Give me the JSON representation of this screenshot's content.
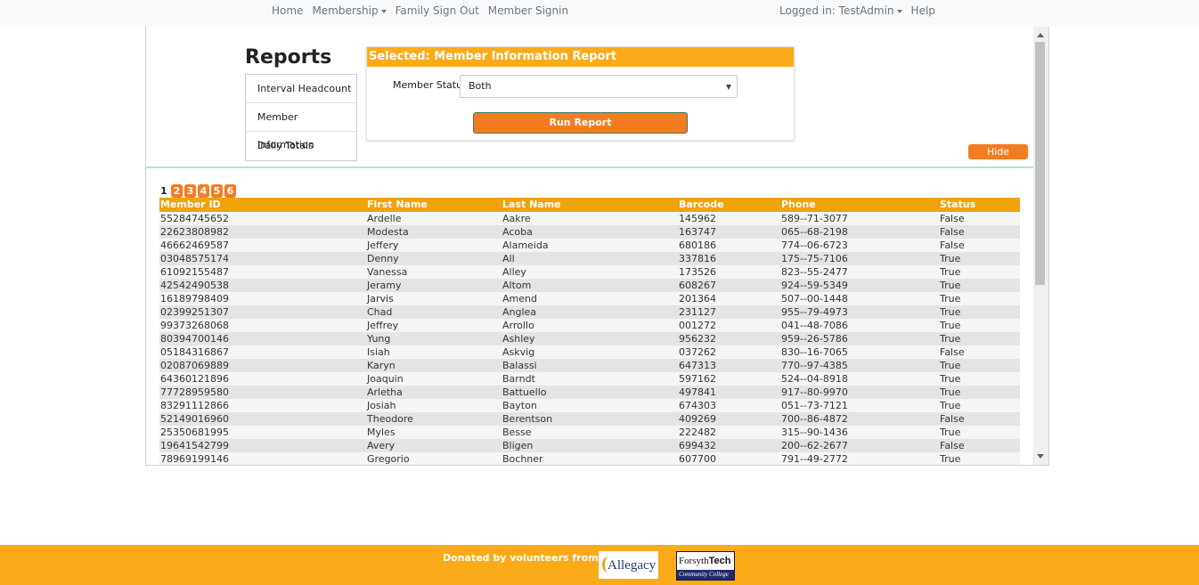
{
  "nav": {
    "home": "Home",
    "membership": "Membership",
    "family_sign_out": "Family Sign Out",
    "member_signin": "Member Signin",
    "logged_in": "Logged in: TestAdmin",
    "help": "Help"
  },
  "reports": {
    "title": "Reports",
    "menu": [
      "Interval Headcount",
      "Member Information",
      "Daily Totals"
    ]
  },
  "panel": {
    "header": "Selected: Member Information Report",
    "status_label": "Member Status:",
    "status_value": "Both",
    "run_button": "Run Report"
  },
  "hide_section": "Hide Section",
  "pager": {
    "current": "1",
    "pages": [
      "2",
      "3",
      "4",
      "5",
      "6"
    ]
  },
  "table": {
    "headers": [
      "Member ID",
      "First Name",
      "Last Name",
      "Barcode",
      "Phone",
      "Status"
    ],
    "rows": [
      [
        "55284745652",
        "Ardelle",
        "Aakre",
        "145962",
        "589--71-3077",
        "False"
      ],
      [
        "22623808982",
        "Modesta",
        "Acoba",
        "163747",
        "065--68-2198",
        "False"
      ],
      [
        "46662469587",
        "Jeffery",
        "Alameida",
        "680186",
        "774--06-6723",
        "False"
      ],
      [
        "03048575174",
        "Denny",
        "All",
        "337816",
        "175--75-7106",
        "True"
      ],
      [
        "61092155487",
        "Vanessa",
        "Alley",
        "173526",
        "823--55-2477",
        "True"
      ],
      [
        "42542490538",
        "Jeramy",
        "Altom",
        "608267",
        "924--59-5349",
        "True"
      ],
      [
        "16189798409",
        "Jarvis",
        "Amend",
        "201364",
        "507--00-1448",
        "True"
      ],
      [
        "02399251307",
        "Chad",
        "Anglea",
        "231127",
        "955--79-4973",
        "True"
      ],
      [
        "99373268068",
        "Jeffrey",
        "Arrollo",
        "001272",
        "041--48-7086",
        "True"
      ],
      [
        "80394700146",
        "Yung",
        "Ashley",
        "956232",
        "959--26-5786",
        "True"
      ],
      [
        "05184316867",
        "Isiah",
        "Askvig",
        "037262",
        "830--16-7065",
        "False"
      ],
      [
        "02087069889",
        "Karyn",
        "Balassi",
        "647313",
        "770--97-4385",
        "True"
      ],
      [
        "64360121896",
        "Joaquin",
        "Barndt",
        "597162",
        "524--04-8918",
        "True"
      ],
      [
        "77728959580",
        "Arletha",
        "Battuello",
        "497841",
        "917--80-9970",
        "True"
      ],
      [
        "83291112866",
        "Josiah",
        "Bayton",
        "674303",
        "051--73-7121",
        "True"
      ],
      [
        "52149016960",
        "Theodore",
        "Berentson",
        "409269",
        "700--86-4872",
        "False"
      ],
      [
        "25350681995",
        "Myles",
        "Besse",
        "222482",
        "315--90-1436",
        "True"
      ],
      [
        "19641542799",
        "Avery",
        "Bligen",
        "699432",
        "200--62-2677",
        "False"
      ],
      [
        "78969199146",
        "Gregorio",
        "Bochner",
        "607700",
        "791--49-2772",
        "True"
      ]
    ]
  },
  "footer": {
    "text": "Donated by volunteers from:",
    "logo_allegacy": "Allegacy",
    "logo_forsyth_main": "Forsyth",
    "logo_forsyth_bold": "Tech",
    "logo_forsyth_sub": "Community College"
  },
  "colors": {
    "accent": "#fbab19",
    "button": "#f47c20",
    "table_header": "#f0a30a"
  }
}
